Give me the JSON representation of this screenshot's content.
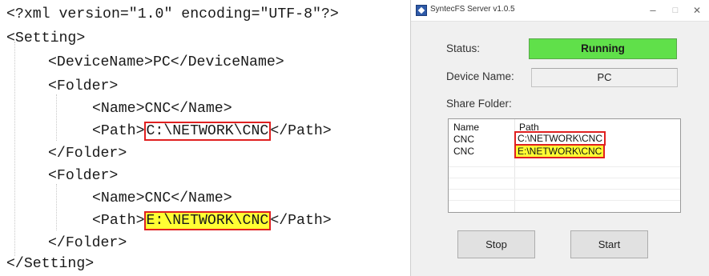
{
  "xml": {
    "declaration": "<?xml version=\"1.0\" encoding=\"UTF-8\"?>",
    "setting_open": "<Setting>",
    "device_name_line": "<DeviceName>PC</DeviceName>",
    "folder_open": "<Folder>",
    "folder1_name_line": "<Name>CNC</Name>",
    "path_open": "<Path>",
    "folder1_path": "C:\\NETWORK\\CNC",
    "path_close": "</Path>",
    "folder_close": "</Folder>",
    "folder2_name_line": "<Name>CNC</Name>",
    "folder2_path": "E:\\NETWORK\\CNC",
    "setting_close": "</Setting>"
  },
  "app": {
    "title": "SyntecFS Server v1.0.5",
    "window_controls": {
      "minimize": "–",
      "maximize": "□",
      "close": "✕"
    },
    "status_label": "Status:",
    "status_value": "Running",
    "status_color": "#60e04a",
    "device_name_label": "Device Name:",
    "device_name_value": "PC",
    "share_folder_label": "Share Folder:",
    "list": {
      "columns": [
        "Name",
        "Path"
      ],
      "rows": [
        {
          "name": "CNC",
          "path": "C:\\NETWORK\\CNC"
        },
        {
          "name": "CNC",
          "path": "E:\\NETWORK\\CNC"
        }
      ]
    },
    "stop_label": "Stop",
    "start_label": "Start"
  },
  "colors": {
    "highlight_border": "#e02020",
    "highlight_fill": "#ffff33"
  }
}
